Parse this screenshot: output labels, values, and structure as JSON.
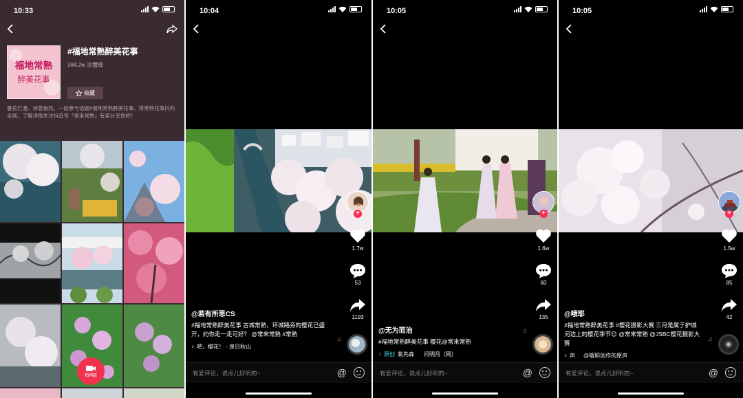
{
  "phone1": {
    "time": "10:33",
    "topic_title": "#福地常熟醉美花事",
    "plays": "384.2w 次播放",
    "fav_label": "收藏",
    "description": "春花烂漫，诗意盎然。一起参与话题#福地常熟醉美花事，将常熟花事抖向全国，了解详情关注抖音号「常来常熟」有奖分享你吧！",
    "shoot_label": "拍同款",
    "cover_text": "福地常熟醉美花事"
  },
  "phone2": {
    "time": "10:04",
    "likes": "1.7w",
    "comments": "53",
    "shares": "1193",
    "author": "@若有所思CS",
    "caption": "#福地常熟醉美花事 古城常熟，环城路旁的樱花已盛开，约你走一走可好？ @常来常熟 #常熟",
    "music": "吧，樱花！ - 泉日秋山",
    "comment_placeholder": "有爱评论，说点儿好听的~"
  },
  "phone3": {
    "time": "10:05",
    "likes": "1.6w",
    "comments": "60",
    "shares": "135",
    "author": "@无为而治",
    "caption": "#福地常熟醉美花事 樱花@常来常熟",
    "music_tag": "原创",
    "music": "紫先森",
    "music2": "问明月（网）",
    "comment_placeholder": "有爱评论，说点儿好听的~"
  },
  "phone4": {
    "time": "10:05",
    "likes": "1.5w",
    "comments": "85",
    "shares": "42",
    "author": "@哦耶",
    "caption": "#福地常熟醉美花事 #樱花摄影大赛 三月是属于护城河边上的樱花季节😊 @常来常熟 @JSBC樱花摄影大赛",
    "music": "@哦耶创作的原声",
    "music_prefix": "声",
    "comment_placeholder": "有爱评论，说点儿好听的~"
  },
  "icons": {
    "back": "back-arrow-icon",
    "share": "share-icon",
    "like": "heart-icon",
    "comment": "comment-icon",
    "forward": "forward-arrow-icon",
    "music": "music-note-icon",
    "camera": "camera-icon",
    "star": "star-icon"
  },
  "colors": {
    "accent": "#fe2c55",
    "topic_bg": "#3a2a31"
  }
}
